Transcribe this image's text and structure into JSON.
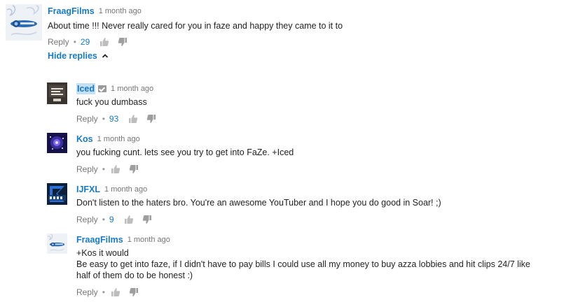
{
  "top_comment": {
    "author": "FraagFilms",
    "time": "1 month ago",
    "text": "About time !!! Never really cared for you in faze and happy they came to it to",
    "reply_label": "Reply",
    "likes": "29",
    "avatar_icon": "fraagfilms-logo-icon"
  },
  "hide_replies_label": "Hide replies",
  "replies": [
    {
      "author": "Iced",
      "verified": true,
      "time": "1 month ago",
      "text": "fuck you dumbass",
      "reply_label": "Reply",
      "likes": "93"
    },
    {
      "author": "Kos",
      "time": "1 month ago",
      "text": "you fucking cunt. lets see you try to get into FaZe. +Iced",
      "reply_label": "Reply",
      "likes": ""
    },
    {
      "author": "IJFXL",
      "time": "1 month ago",
      "text": "Don't listen to the haters bro. You're an awesome YouTuber and I hope you do good in Soar! ;)",
      "reply_label": "Reply",
      "likes": "9"
    },
    {
      "author": "FraagFilms",
      "time": "1 month ago",
      "text_lines": [
        "+Kos it would",
        "Be easy to get into faze, if I didn't have to pay bills I could use all my money to buy azza lobbies and hit clips 24/7 like",
        "half of them do to be honest :)"
      ],
      "reply_label": "Reply",
      "likes": ""
    }
  ],
  "colors": {
    "link": "#167ac6",
    "meta": "#767676",
    "text": "#222222",
    "highlight": "#c5dff5"
  }
}
